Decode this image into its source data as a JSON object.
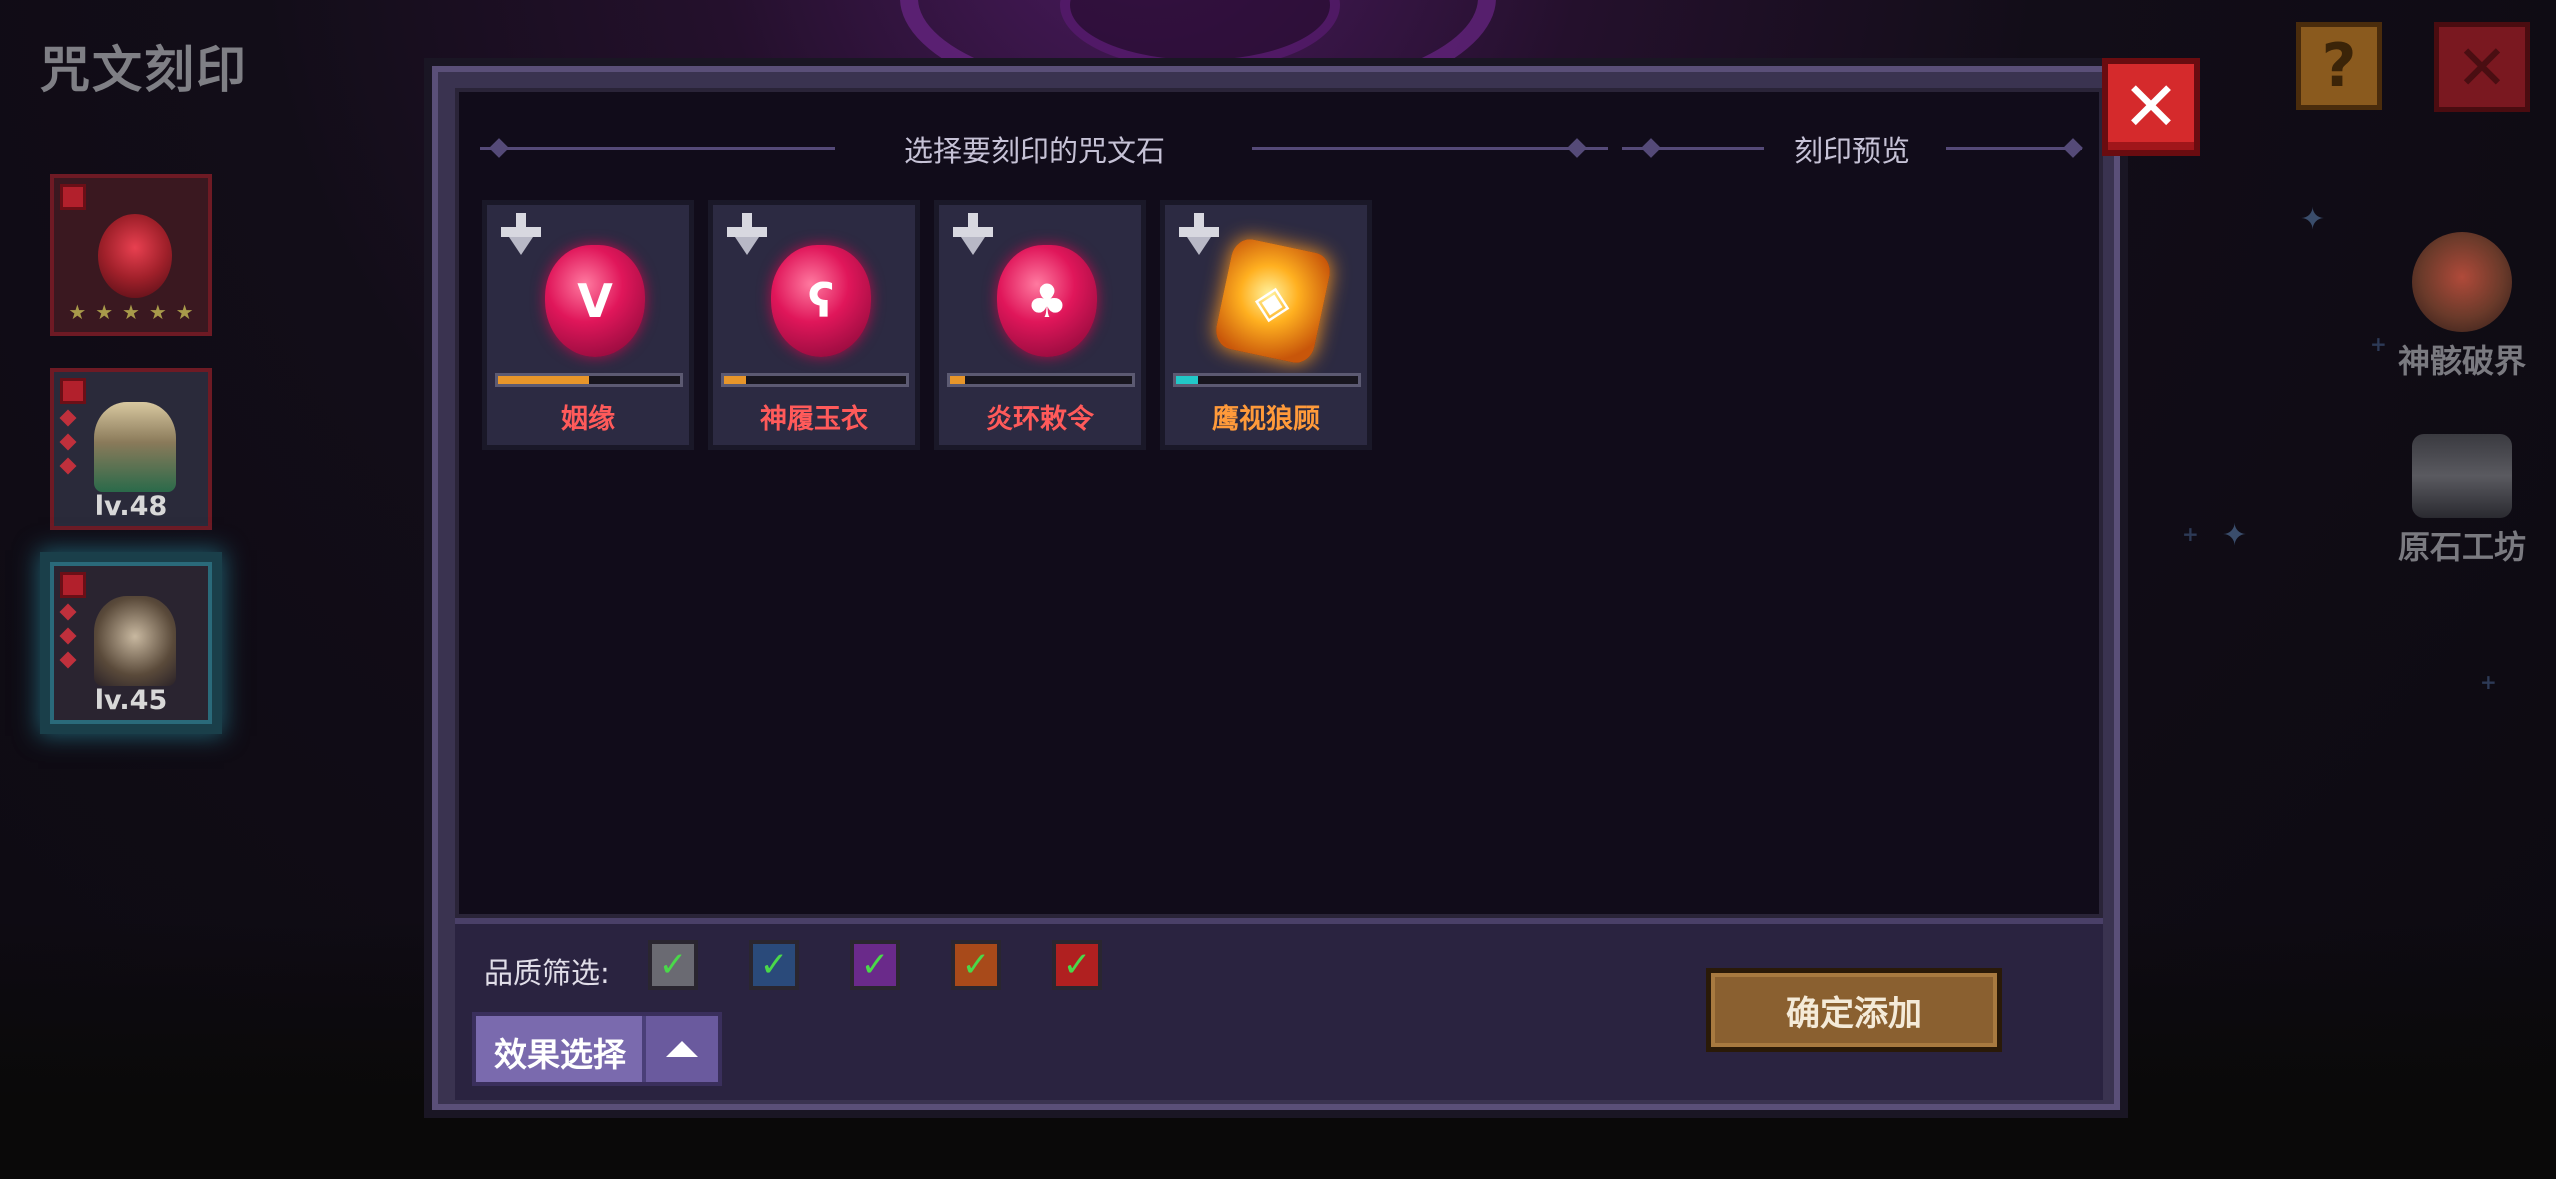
{
  "screen": {
    "title": "咒文刻印"
  },
  "heroes": [
    {
      "level": "",
      "stars": [
        "★",
        "★",
        "★",
        "★",
        "★"
      ]
    },
    {
      "level": "lv.48"
    },
    {
      "level": "lv.45"
    }
  ],
  "top_buttons": {
    "help": "?",
    "close": "✕"
  },
  "side_menu": [
    {
      "label": "神骸破界",
      "icon": "skull-orb-icon"
    },
    {
      "label": "原石工坊",
      "icon": "anvil-icon"
    }
  ],
  "panel": {
    "select_header": "选择要刻印的咒文石",
    "preview_header": "刻印预览",
    "close": "✕",
    "runes": [
      {
        "name": "姻缘",
        "symbol": "V",
        "gem_type": "red",
        "progress": 0.5,
        "progress_color": "#e8962a",
        "name_color": "#ff5a5a"
      },
      {
        "name": "神履玉衣",
        "symbol": "ʕ",
        "gem_type": "red",
        "progress": 0.12,
        "progress_color": "#e8962a",
        "name_color": "#ff5a5a"
      },
      {
        "name": "炎环敕令",
        "symbol": "♣",
        "gem_type": "red",
        "progress": 0.08,
        "progress_color": "#e8962a",
        "name_color": "#ff5a5a"
      },
      {
        "name": "鹰视狼顾",
        "symbol": "◈",
        "gem_type": "gold",
        "progress": 0.12,
        "progress_color": "#22c8c8",
        "name_color": "#ff9a3a"
      }
    ],
    "quality_filter": {
      "label": "品质筛选:",
      "options": [
        {
          "color": "#6a6a72",
          "checked": true
        },
        {
          "color": "#2a4a7a",
          "checked": true
        },
        {
          "color": "#6a2a8a",
          "checked": true
        },
        {
          "color": "#a84a1a",
          "checked": true
        },
        {
          "color": "#b02020",
          "checked": true
        }
      ]
    },
    "effect_select": "效果选择",
    "confirm": "确定添加"
  }
}
